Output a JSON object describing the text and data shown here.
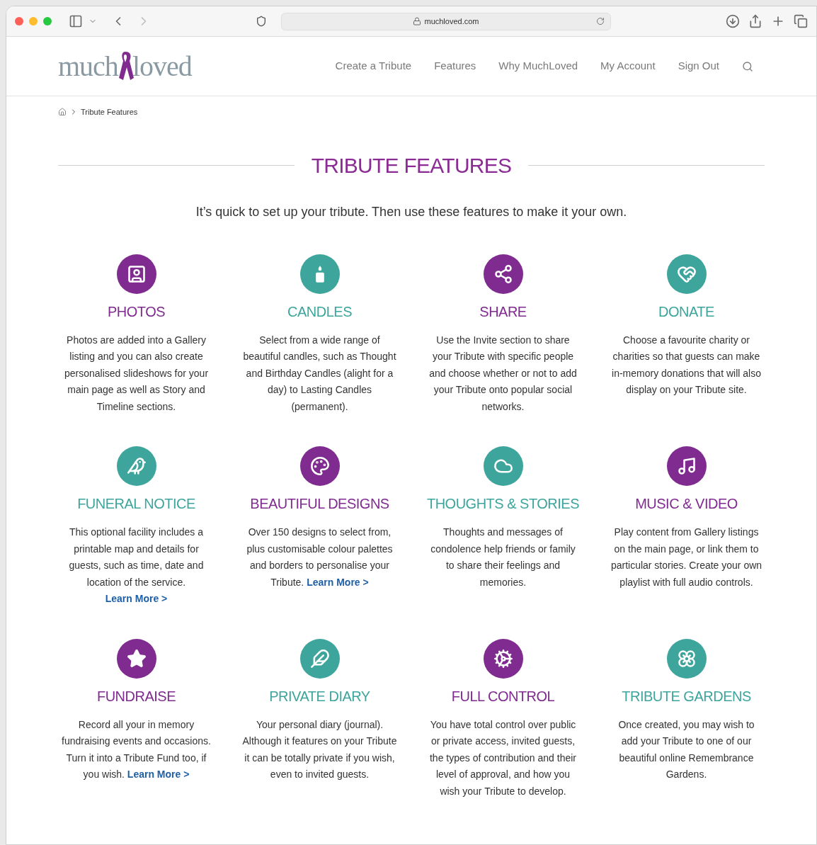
{
  "browser": {
    "url": "muchloved.com"
  },
  "header": {
    "logo_left": "much",
    "logo_right": "loved",
    "nav": [
      {
        "label": "Create a Tribute"
      },
      {
        "label": "Features"
      },
      {
        "label": "Why MuchLoved"
      },
      {
        "label": "My Account"
      },
      {
        "label": "Sign Out"
      }
    ]
  },
  "breadcrumb": {
    "current": "Tribute Features"
  },
  "heading": "TRIBUTE FEATURES",
  "intro": "It’s quick to set up your tribute. Then use these features to make it your own.",
  "features": [
    {
      "kind": "photo",
      "color": "#7f2b8f",
      "title": "PHOTOS",
      "body": "Photos are added into a Gallery listing and you can also create personalised slideshows for your main page as well as Story and Timeline sections."
    },
    {
      "kind": "candle",
      "color": "#3da59c",
      "title": "CANDLES",
      "body": "Select from a wide range of beautiful candles, such as Thought and Birthday Candles (alight for a day) to Lasting Candles (permanent)."
    },
    {
      "kind": "share",
      "color": "#7f2b8f",
      "title": "SHARE",
      "body": "Use the Invite section to share your Tribute with specific people and choose whether or not to add your Tribute onto popular social networks."
    },
    {
      "kind": "donate",
      "color": "#3da59c",
      "title": "DONATE",
      "body": "Choose a favourite charity or charities so that guests can make in-memory donations that will also display on your Tribute site."
    },
    {
      "kind": "dove",
      "color": "#3da59c",
      "title": "FUNERAL NOTICE",
      "body": "This optional facility includes a printable map and details for guests, such as time, date and location of the service.",
      "link_below": "Learn More >"
    },
    {
      "kind": "palette",
      "color": "#7f2b8f",
      "title": "BEAUTIFUL DESIGNS",
      "body": "Over 150 designs to select from, plus customisable colour palettes and borders to personalise your Tribute.",
      "link": "Learn More >"
    },
    {
      "kind": "thought",
      "color": "#3da59c",
      "title": "THOUGHTS & STORIES",
      "body": "Thoughts and messages of condolence help friends or family to share their feelings and memories."
    },
    {
      "kind": "music",
      "color": "#7f2b8f",
      "title": "MUSIC & VIDEO",
      "body": "Play content from Gallery listings on the main page, or link them to particular stories. Create your own playlist with full audio controls."
    },
    {
      "kind": "star",
      "color": "#7f2b8f",
      "title": "FUNDRAISE",
      "body": "Record all your in memory fundraising events and occasions. Turn it into a Tribute Fund too, if you wish.",
      "link": "Learn More >"
    },
    {
      "kind": "quill",
      "color": "#3da59c",
      "title": "PRIVATE DIARY",
      "body": "Your personal diary (journal). Although it features on your Tribute it can be totally private if you wish, even to invited guests."
    },
    {
      "kind": "gears",
      "color": "#7f2b8f",
      "title": "FULL CONTROL",
      "body": "You have total control over public or private access, invited guests, the types of contribution and their level of approval, and how you wish your Tribute to develop."
    },
    {
      "kind": "flower",
      "color": "#3da59c",
      "title": "TRIBUTE GARDENS",
      "body": "Once created, you may wish to add your Tribute to one of our beautiful online Remembrance Gardens."
    }
  ]
}
